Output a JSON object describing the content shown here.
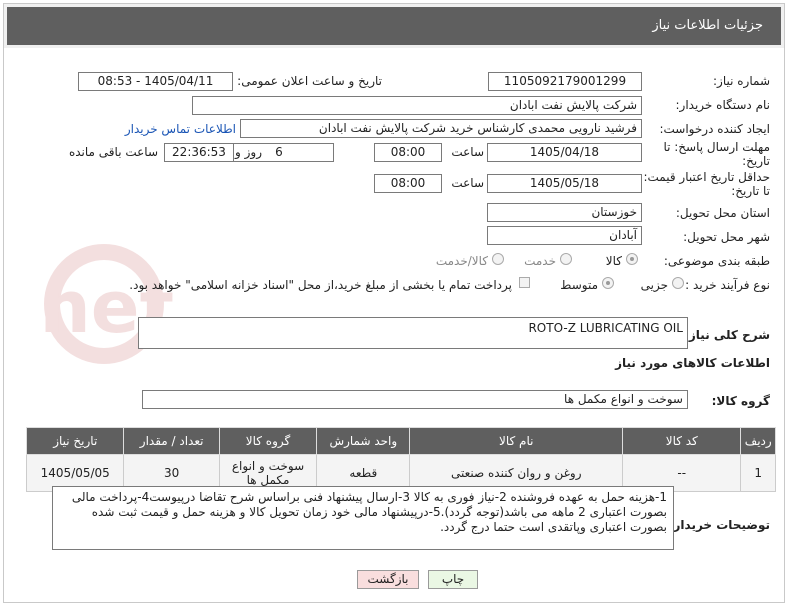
{
  "header": {
    "title": "جزئیات اطلاعات نیاز"
  },
  "need_number": {
    "label": "شماره نیاز:",
    "value": "1105092179001299"
  },
  "announce_date": {
    "label": "تاریخ و ساعت اعلان عمومی:",
    "value": "1405/04/11 - 08:53"
  },
  "buyer_org": {
    "label": "نام دستگاه خریدار:",
    "value": "شرکت پالایش نفت ابادان"
  },
  "requester": {
    "label": "ایجاد کننده درخواست:",
    "value": "فرشید نارویی محمدی کارشناس خرید  شرکت پالایش نفت ابادان",
    "contact_link": "اطلاعات تماس خریدار"
  },
  "reply_deadline": {
    "label_line1": "مهلت ارسال پاسخ: تا",
    "label_line2": "تاریخ:",
    "date": "1405/04/18",
    "time_label": "ساعت",
    "time": "08:00",
    "days": "6",
    "days_label": "روز و",
    "remaining": "22:36:53",
    "remaining_label": "ساعت باقی مانده"
  },
  "price_validity": {
    "label_line1": "حداقل تاریخ اعتبار قیمت:",
    "label_line2": "تا تاریخ:",
    "date": "1405/05/18",
    "time_label": "ساعت",
    "time": "08:00"
  },
  "province": {
    "label": "استان محل تحویل:",
    "value": "خوزستان"
  },
  "city": {
    "label": "شهر محل تحویل:",
    "value": "آبادان"
  },
  "category": {
    "label": "طبقه بندی موضوعی:",
    "options": [
      "کالا",
      "خدمت",
      "کالا/خدمت"
    ]
  },
  "process": {
    "label": "نوع فرآیند خرید :",
    "options": [
      "جزیی",
      "متوسط"
    ],
    "note": "پرداخت تمام یا بخشی از مبلغ خرید،از محل \"اسناد خزانه اسلامی\" خواهد بود."
  },
  "general_desc": {
    "label": "شرح کلی نیاز:",
    "value": "ROTO-Z LUBRICATING OIL"
  },
  "goods_info": {
    "title": "اطلاعات کالاهای مورد نیاز"
  },
  "goods_group": {
    "label": "گروه کالا:",
    "value": "سوخت و انواع مکمل ها"
  },
  "table": {
    "headers": [
      "ردیف",
      "کد کالا",
      "نام کالا",
      "واحد شمارش",
      "گروه کالا",
      "تعداد / مقدار",
      "تاریخ نیاز"
    ],
    "rows": [
      [
        "1",
        "--",
        "روغن و روان کننده صنعتی",
        "قطعه",
        "سوخت و انواع مکمل ها",
        "30",
        "1405/05/05"
      ]
    ]
  },
  "buyer_notes": {
    "label": "توضیحات خریدار:",
    "value": "1-هزینه حمل به عهده فروشنده 2-نیاز فوری به کالا 3-ارسال پیشنهاد فنی براساس شرح تقاضا درپیوست4-پرداخت مالی بصورت اعتباری 2 ماهه می باشد(توجه گردد).5-درپیشنهاد مالی خود زمان تحویل کالا و هزینه حمل و قیمت ثبت شده بصورت اعتباری وپاتقدی است حتما درج گردد."
  },
  "buttons": {
    "print": "چاپ",
    "back": "بازگشت"
  },
  "watermark": {
    "text": "AriaTender.net"
  },
  "colors": {
    "header_bg": "#5f5f5f",
    "link": "#1a55b5",
    "print_btn": "#eaf7e4",
    "back_btn": "#f9dede"
  }
}
